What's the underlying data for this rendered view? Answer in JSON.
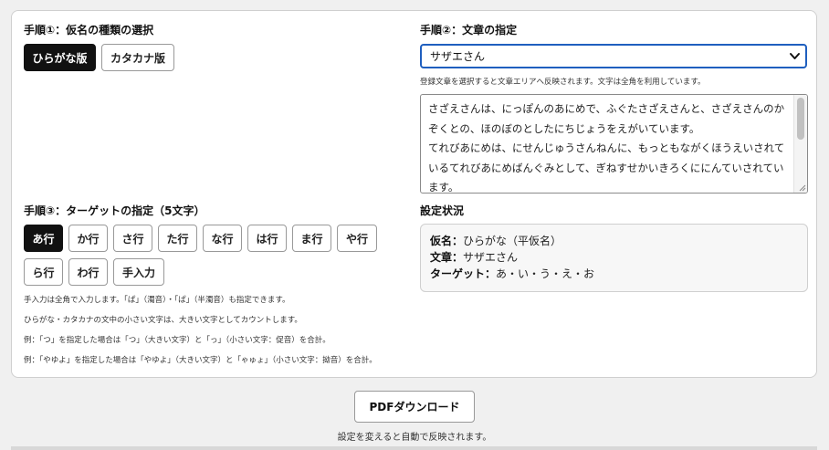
{
  "step1": {
    "heading": "手順①：仮名の種類の選択",
    "options": [
      "ひらがな版",
      "カタカナ版"
    ],
    "selected": "ひらがな版"
  },
  "step2": {
    "heading": "手順②：文章の指定",
    "selected_text": "サザエさん",
    "note": "登録文章を選択すると文章エリアへ反映されます。文字は全角を利用しています。",
    "body": "さざえさんは、にっぽんのあにめで、ふぐたさざえさんと、さざえさんのかぞくとの、ほのぼのとしたにちじょうをえがいています。\nてれびあにめは、にせんじゅうさんねんに、もっともながくほうえいされているてれびあにめばんぐみとして、ぎねすせかいきろくににんていされています。"
  },
  "step3": {
    "heading": "手順③：ターゲットの指定（5文字）",
    "row1": [
      "あ行",
      "か行",
      "さ行",
      "た行",
      "な行",
      "は行",
      "ま行",
      "や行"
    ],
    "row2": [
      "ら行",
      "わ行",
      "手入力"
    ],
    "selected": "あ行",
    "notes": [
      "手入力は全角で入力します。「ぱ」（濁音）・「ぱ」（半濁音）も指定できます。",
      "ひらがな・カタカナの文中の小さい文字は、大きい文字としてカウントします。",
      "例：「つ」を指定した場合は「つ」（大きい文字）と「っ」（小さい文字：促音）を合計。",
      "例：「やゆよ」を指定した場合は「やゆよ」（大きい文字）と「ゃゅょ」（小さい文字：拗音）を合計。"
    ]
  },
  "status": {
    "heading": "設定状況",
    "kana_label": "仮名：",
    "kana_value": "ひらがな（平仮名）",
    "text_label": "文章：",
    "text_value": "サザエさん",
    "target_label": "ターゲット：",
    "target_value": "あ・い・う・え・お"
  },
  "footer": {
    "pdf_button": "PDFダウンロード",
    "note": "設定を変えると自動で反映されます。"
  },
  "colors": {
    "active_button": "#111111",
    "select_focus": "#1f5fbf"
  }
}
